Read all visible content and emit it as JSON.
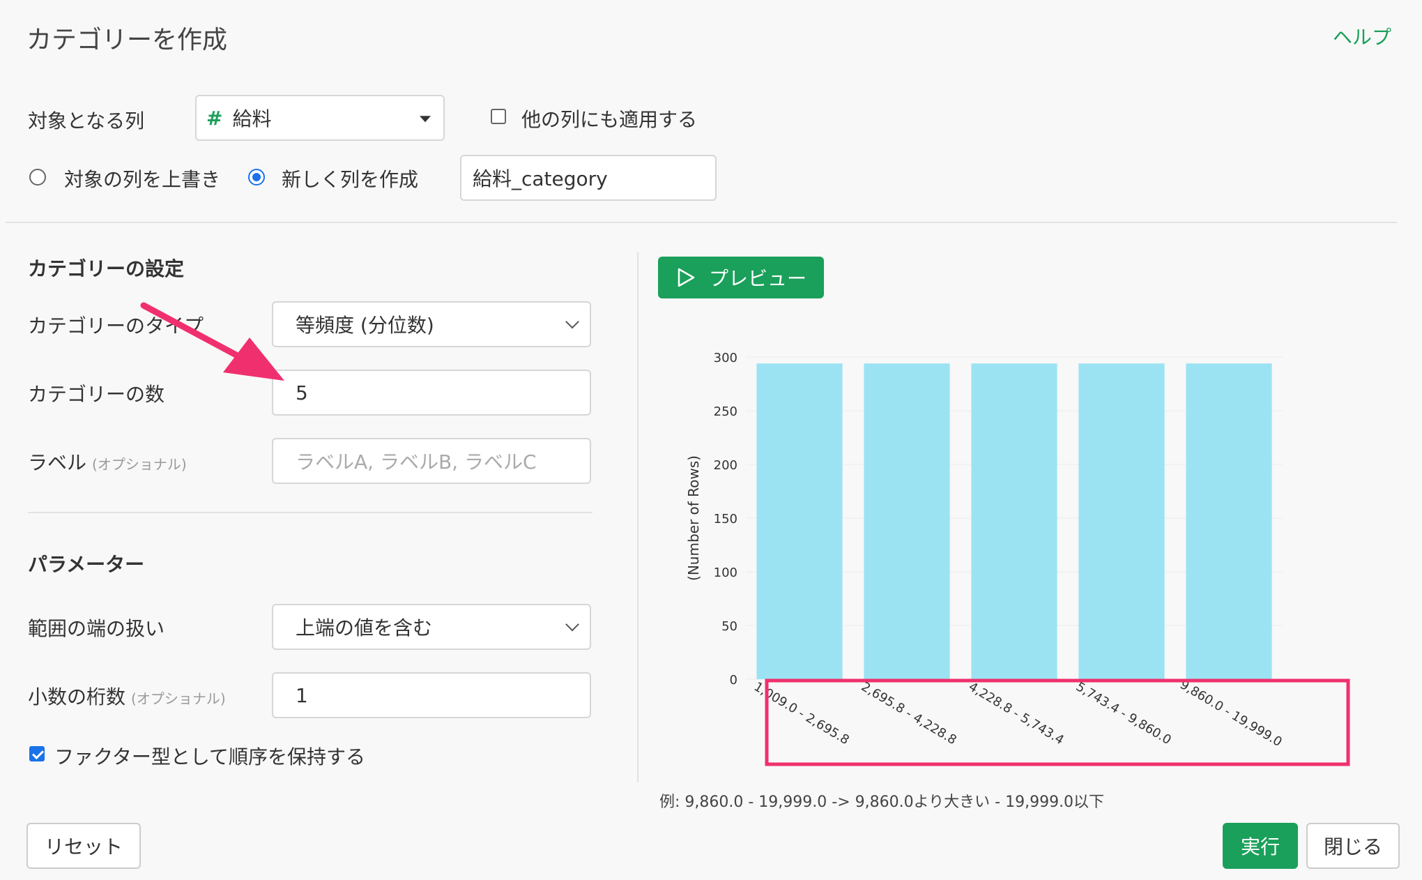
{
  "header": {
    "title": "カテゴリーを作成",
    "help": "ヘルプ"
  },
  "target": {
    "label": "対象となる列",
    "column_icon": "#",
    "column_value": "給料",
    "apply_other_label": "他の列にも適用する",
    "apply_other_checked": false
  },
  "mode": {
    "overwrite_label": "対象の列を上書き",
    "new_label": "新しく列を作成",
    "selected": "new",
    "new_column_name": "給料_category"
  },
  "category_settings": {
    "heading": "カテゴリーの設定",
    "type_label": "カテゴリーのタイプ",
    "type_value": "等頻度 (分位数)",
    "count_label": "カテゴリーの数",
    "count_value": "5",
    "label_label": "ラベル",
    "label_optional": "(オプショナル)",
    "label_placeholder": "ラベルA, ラベルB, ラベルC"
  },
  "parameters": {
    "heading": "パラメーター",
    "edge_label": "範囲の端の扱い",
    "edge_value": "上端の値を含む",
    "decimal_label": "小数の桁数",
    "decimal_optional": "(オプショナル)",
    "decimal_value": "1",
    "factor_label": "ファクター型として順序を保持する",
    "factor_checked": true
  },
  "preview": {
    "button": "プレビュー"
  },
  "chart_data": {
    "type": "bar",
    "ylabel": "(Number of Rows)",
    "ylim": [
      0,
      300
    ],
    "yticks": [
      0,
      50,
      100,
      150,
      200,
      250,
      300
    ],
    "categories": [
      "1,009.0 - 2,695.8",
      "2,695.8 - 4,228.8",
      "4,228.8 - 5,743.4",
      "5,743.4 - 9,860.0",
      "9,860.0 - 19,999.0"
    ],
    "values": [
      294,
      294,
      294,
      294,
      294
    ],
    "bar_color": "#9be3f3",
    "highlight_color": "#f0306e"
  },
  "example_note": "例: 9,860.0 - 19,999.0 -> 9,860.0より大きい - 19,999.0以下",
  "footer": {
    "reset": "リセット",
    "run": "実行",
    "close": "閉じる"
  },
  "colors": {
    "accent": "#1aa05a",
    "radio": "#1a73e8",
    "arrow": "#f0306e"
  }
}
